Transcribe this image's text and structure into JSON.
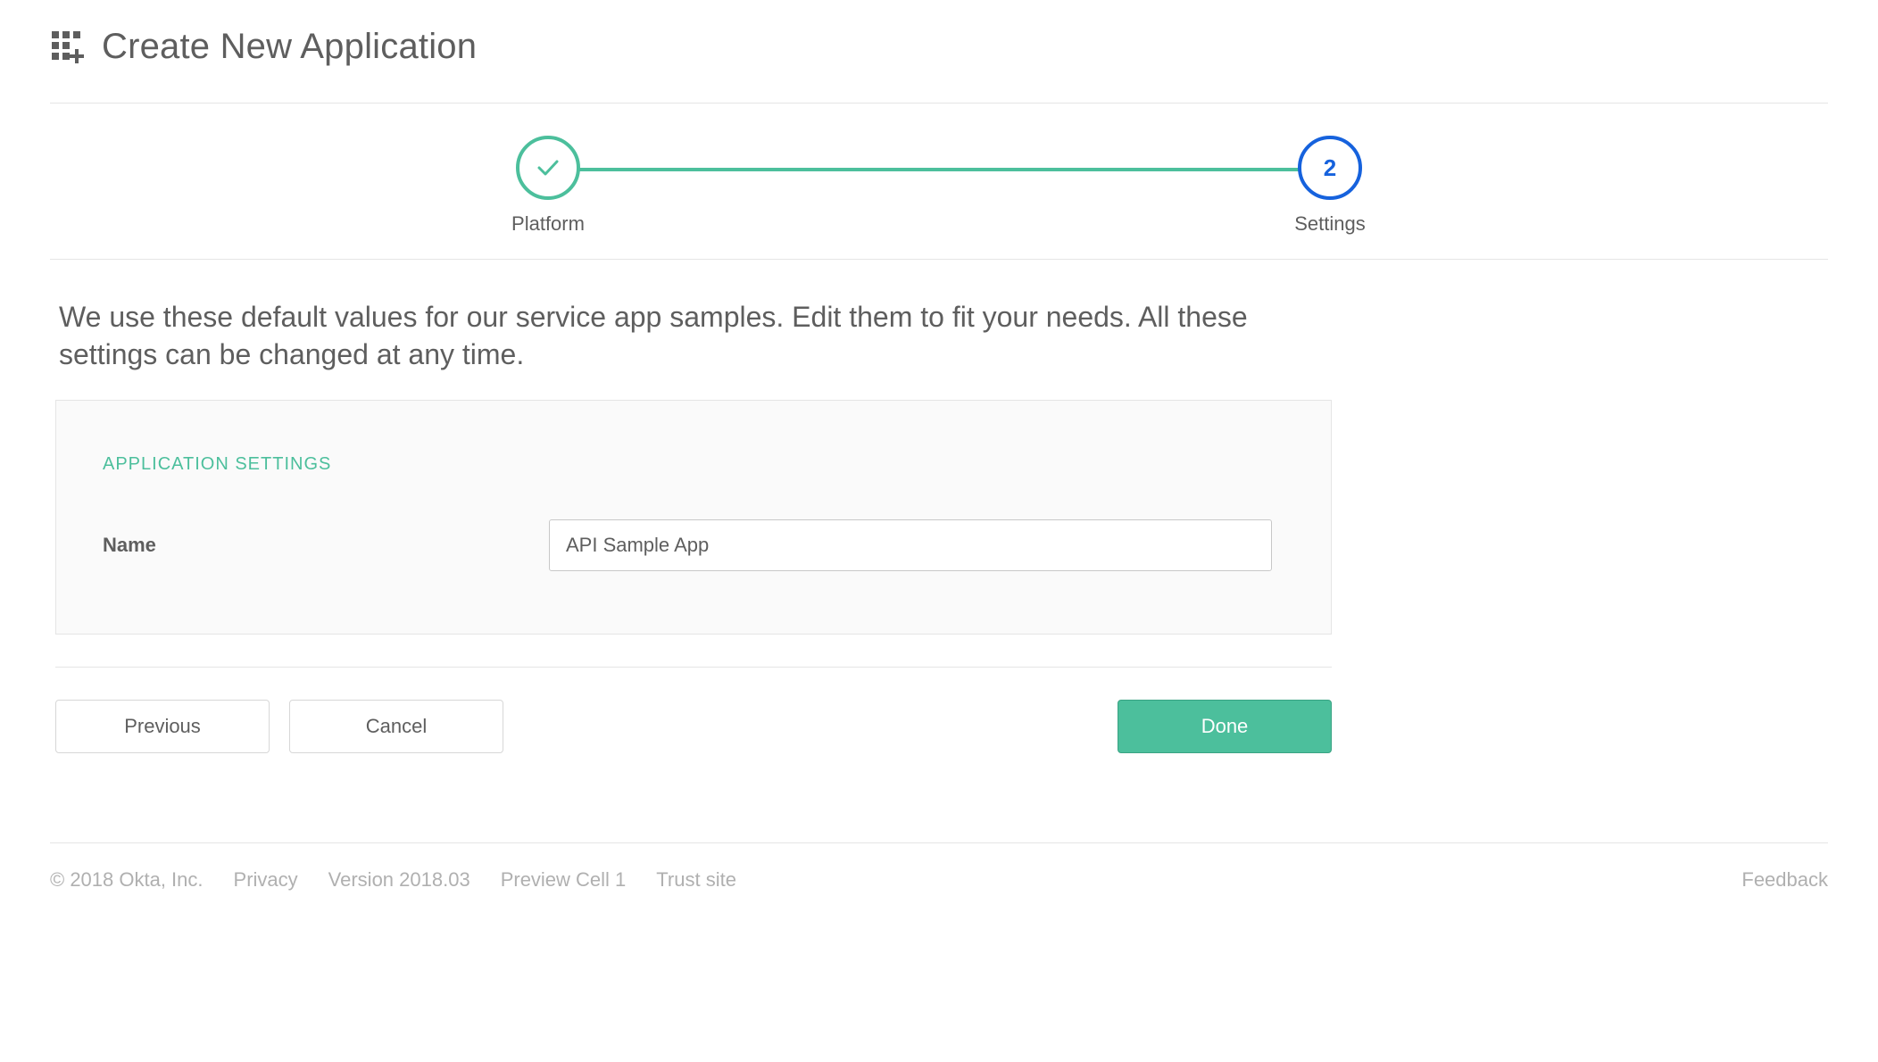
{
  "header": {
    "title": "Create New Application"
  },
  "stepper": {
    "step1": {
      "label": "Platform",
      "state": "complete"
    },
    "step2": {
      "label": "Settings",
      "state": "active",
      "number": "2"
    }
  },
  "intro": "We use these default values for our service app samples. Edit them to fit your needs. All these settings can be changed at any time.",
  "panel": {
    "title": "APPLICATION SETTINGS",
    "name_label": "Name",
    "name_value": "API Sample App"
  },
  "actions": {
    "previous": "Previous",
    "cancel": "Cancel",
    "done": "Done"
  },
  "footer": {
    "copyright": "© 2018 Okta, Inc.",
    "privacy": "Privacy",
    "version": "Version 2018.03",
    "cell": "Preview Cell 1",
    "trust": "Trust site",
    "feedback": "Feedback"
  }
}
